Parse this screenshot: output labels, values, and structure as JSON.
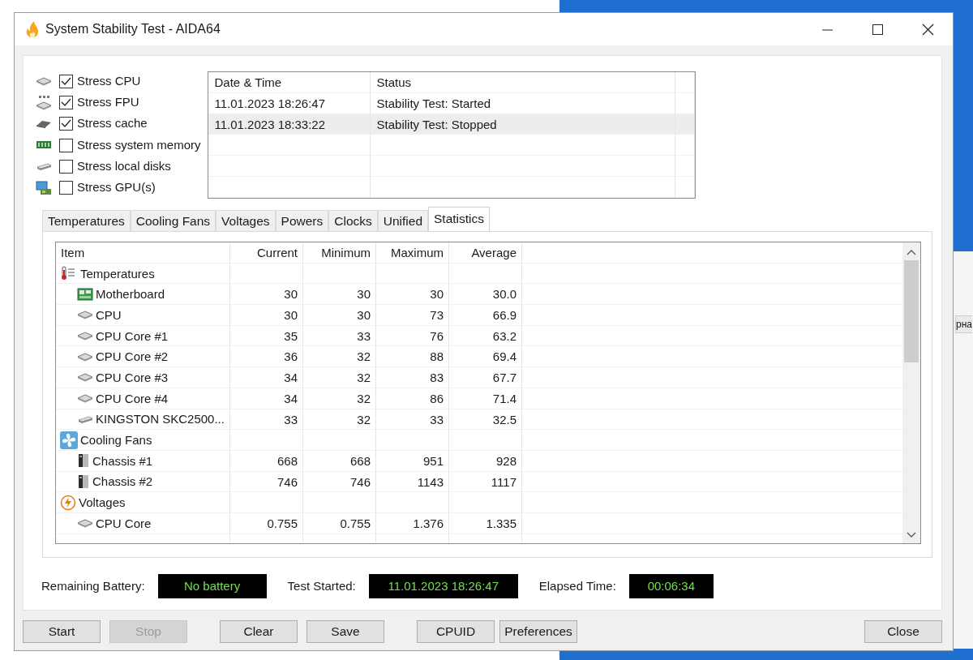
{
  "window": {
    "title": "System Stability Test - AIDA64"
  },
  "stress_options": [
    {
      "label": "Stress CPU",
      "checked": true,
      "kind": "cpu"
    },
    {
      "label": "Stress FPU",
      "checked": true,
      "kind": "fpu"
    },
    {
      "label": "Stress cache",
      "checked": true,
      "kind": "cache"
    },
    {
      "label": "Stress system memory",
      "checked": false,
      "kind": "memory"
    },
    {
      "label": "Stress local disks",
      "checked": false,
      "kind": "disk"
    },
    {
      "label": "Stress GPU(s)",
      "checked": false,
      "kind": "gpu"
    }
  ],
  "log": {
    "columns": [
      "Date & Time",
      "Status"
    ],
    "rows": [
      {
        "cells": [
          "11.01.2023 18:26:47",
          "Stability Test: Started"
        ],
        "selected": false
      },
      {
        "cells": [
          "11.01.2023 18:33:22",
          "Stability Test: Stopped"
        ],
        "selected": true
      }
    ]
  },
  "tabs": [
    {
      "label": "Temperatures",
      "selected": false
    },
    {
      "label": "Cooling Fans",
      "selected": false
    },
    {
      "label": "Voltages",
      "selected": false
    },
    {
      "label": "Powers",
      "selected": false
    },
    {
      "label": "Clocks",
      "selected": false
    },
    {
      "label": "Unified",
      "selected": false
    },
    {
      "label": "Statistics",
      "selected": true
    }
  ],
  "statistics": {
    "columns": [
      "Item",
      "Current",
      "Minimum",
      "Maximum",
      "Average"
    ],
    "groups": [
      {
        "label": "Temperatures",
        "kind": "temperature",
        "children": [
          {
            "label": "Motherboard",
            "kind": "motherboard",
            "values": [
              "30",
              "30",
              "30",
              "30.0"
            ]
          },
          {
            "label": "CPU",
            "kind": "cpu",
            "values": [
              "30",
              "30",
              "73",
              "66.9"
            ]
          },
          {
            "label": "CPU Core #1",
            "kind": "cpu",
            "values": [
              "35",
              "33",
              "76",
              "63.2"
            ]
          },
          {
            "label": "CPU Core #2",
            "kind": "cpu",
            "values": [
              "36",
              "32",
              "88",
              "69.4"
            ]
          },
          {
            "label": "CPU Core #3",
            "kind": "cpu",
            "values": [
              "34",
              "32",
              "83",
              "67.7"
            ]
          },
          {
            "label": "CPU Core #4",
            "kind": "cpu",
            "values": [
              "34",
              "32",
              "86",
              "71.4"
            ]
          },
          {
            "label": "KINGSTON SKC2500...",
            "kind": "disk",
            "values": [
              "33",
              "32",
              "33",
              "32.5"
            ]
          }
        ]
      },
      {
        "label": "Cooling Fans",
        "kind": "fan",
        "children": [
          {
            "label": "Chassis #1",
            "kind": "chassis",
            "values": [
              "668",
              "668",
              "951",
              "928"
            ]
          },
          {
            "label": "Chassis #2",
            "kind": "chassis",
            "values": [
              "746",
              "746",
              "1143",
              "1117"
            ]
          }
        ]
      },
      {
        "label": "Voltages",
        "kind": "voltage",
        "children": [
          {
            "label": "CPU Core",
            "kind": "cpu",
            "values": [
              "0.755",
              "0.755",
              "1.376",
              "1.335"
            ]
          }
        ]
      }
    ]
  },
  "status": [
    {
      "label": "Remaining Battery:",
      "value": "No battery"
    },
    {
      "label": "Test Started:",
      "value": "11.01.2023 18:26:47"
    },
    {
      "label": "Elapsed Time:",
      "value": "00:06:34"
    }
  ],
  "buttons": [
    {
      "label": "Start",
      "disabled": false
    },
    {
      "label": "Stop",
      "disabled": true
    },
    {
      "label": "Clear",
      "disabled": false
    },
    {
      "label": "Save",
      "disabled": false
    },
    {
      "label": "CPUID",
      "disabled": false
    },
    {
      "label": "Preferences",
      "disabled": false
    },
    {
      "label": "Close",
      "disabled": false
    }
  ],
  "background_window": {
    "partial_text": "рна"
  }
}
